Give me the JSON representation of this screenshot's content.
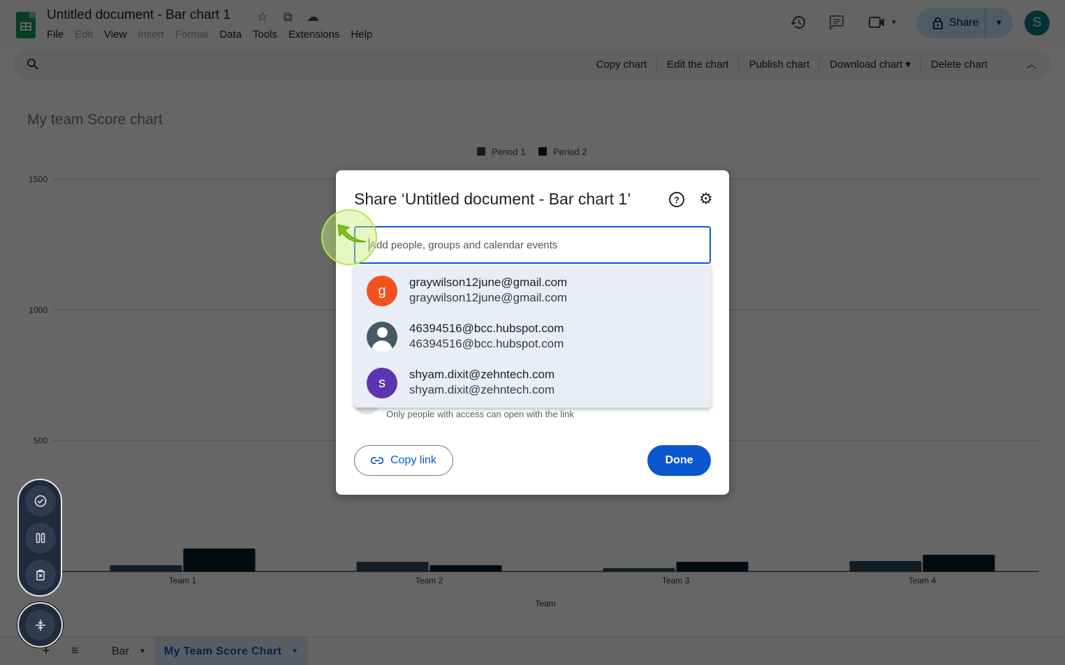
{
  "app": {
    "doc_title": "Untitled document - Bar chart 1",
    "title_icons": [
      "star-icon",
      "move-to-folder-icon",
      "cloud-saved-icon"
    ],
    "menu": [
      {
        "label": "File",
        "disabled": false
      },
      {
        "label": "Edit",
        "disabled": true
      },
      {
        "label": "View",
        "disabled": false
      },
      {
        "label": "Insert",
        "disabled": true
      },
      {
        "label": "Format",
        "disabled": true
      },
      {
        "label": "Data",
        "disabled": false
      },
      {
        "label": "Tools",
        "disabled": false
      },
      {
        "label": "Extensions",
        "disabled": false
      },
      {
        "label": "Help",
        "disabled": false
      }
    ],
    "share_label": "Share",
    "account_initial": "S"
  },
  "toolbar": {
    "actions": [
      "Copy chart",
      "Edit the chart",
      "Publish chart",
      "Download chart ▾",
      "Delete chart"
    ]
  },
  "chart_data": {
    "type": "bar",
    "title": "My team Score chart",
    "xlabel": "Team",
    "ylabel": "",
    "categories": [
      "Team 1",
      "Team 2",
      "Team 3",
      "Team 4"
    ],
    "series": [
      {
        "name": "Period 1",
        "color": "#2e4a5c",
        "values": [
          24,
          37,
          13,
          40
        ]
      },
      {
        "name": "Period 2",
        "color": "#02202c",
        "values": [
          88,
          24,
          37,
          64
        ]
      }
    ],
    "ylim": [
      0,
      1500
    ],
    "yticks": [
      500,
      1000,
      1500
    ],
    "grid": true,
    "legend": "top-center"
  },
  "sheet_tabs": {
    "tabs": [
      {
        "label": "Bar",
        "active": false
      },
      {
        "label": "My Team Score Chart",
        "active": true
      }
    ]
  },
  "recorder": {
    "buttons": [
      "check-icon",
      "pause-icon",
      "discard-icon"
    ],
    "minimize": "collapse-icon"
  },
  "dialog": {
    "title": "Share ‘Untitled document - Bar chart 1’",
    "input_placeholder": "Add people, groups and calendar events",
    "input_value": "",
    "suggestions": [
      {
        "initial": "g",
        "avatar_color": "#f4511e",
        "name": "graywilson12june@gmail.com",
        "email": "graywilson12june@gmail.com",
        "generic": false
      },
      {
        "initial": "",
        "avatar_color": "#455a64",
        "name": "46394516@bcc.hubspot.com",
        "email": "46394516@bcc.hubspot.com",
        "generic": true
      },
      {
        "initial": "s",
        "avatar_color": "#5e35b1",
        "name": "shyam.dixit@zehntech.com",
        "email": "shyam.dixit@zehntech.com",
        "generic": false
      }
    ],
    "general_access_sub": "Only people with access can open with the link",
    "copy_link_label": "Copy link",
    "done_label": "Done"
  }
}
